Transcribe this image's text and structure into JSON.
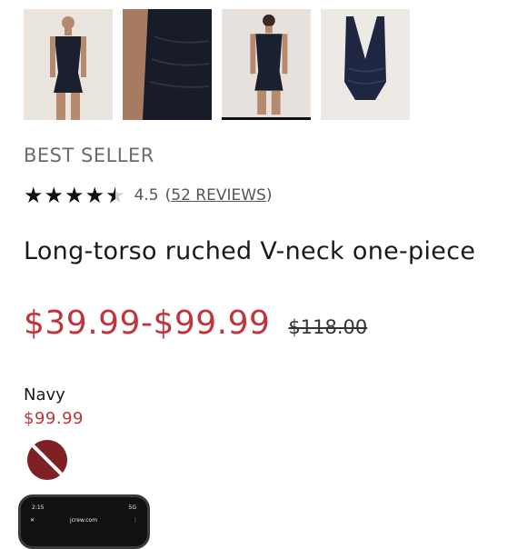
{
  "gallery": {
    "thumbnails": [
      {
        "alt": "front-view"
      },
      {
        "alt": "side-detail"
      },
      {
        "alt": "back-view"
      },
      {
        "alt": "flat-lay"
      }
    ],
    "selected_index": 2
  },
  "product": {
    "badge": "BEST SELLER",
    "rating": {
      "value": "4.5",
      "stars": 4.5,
      "reviews_label": "52 REVIEWS"
    },
    "title": "Long-torso ruched V-neck one-piece",
    "price_range": "$39.99-$99.99",
    "original_price": "$118.00",
    "selected_color": {
      "name": "Navy",
      "price": "$99.99",
      "swatch_color": "#7e2024"
    }
  },
  "phone_overlay": {
    "time": "2:15",
    "status_right": "5G",
    "url": "jcrew.com"
  }
}
